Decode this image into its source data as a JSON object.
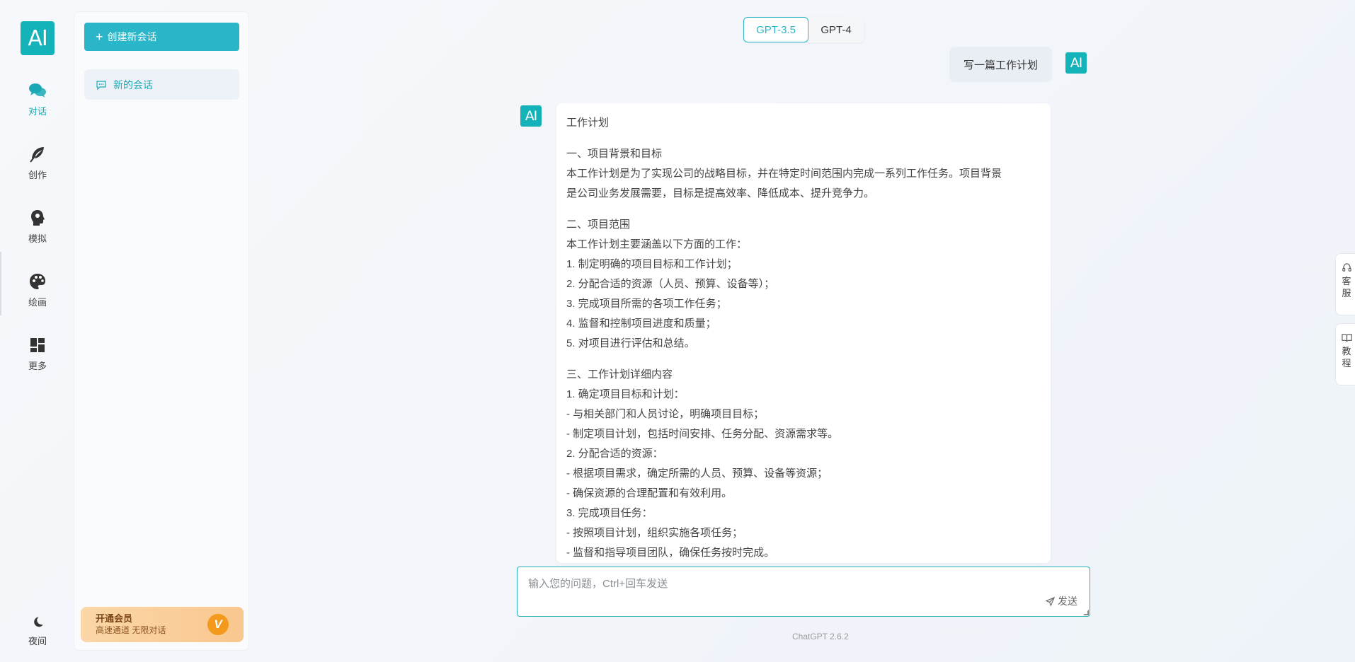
{
  "logo_text": "AI",
  "nav": {
    "items": [
      {
        "label": "对话",
        "icon": "chat-bubbles-icon"
      },
      {
        "label": "创作",
        "icon": "feather-icon"
      },
      {
        "label": "模拟",
        "icon": "head-profile-icon"
      },
      {
        "label": "绘画",
        "icon": "palette-icon"
      },
      {
        "label": "更多",
        "icon": "grid-icon"
      }
    ],
    "night_label": "夜间"
  },
  "sidebar": {
    "new_chat_label": "创建新会话",
    "sessions": [
      {
        "label": "新的会话"
      }
    ],
    "vip": {
      "title": "开通会员",
      "subtitle": "高速通道 无限对话",
      "badge": "V"
    }
  },
  "models": {
    "options": [
      "GPT-3.5",
      "GPT-4"
    ],
    "selected": "GPT-3.5"
  },
  "conversation": {
    "user_message": "写一篇工作计划",
    "user_avatar": "AI",
    "ai_avatar": "AI",
    "answer_paragraphs": [
      [
        "工作计划"
      ],
      [
        "一、项目背景和目标",
        "本工作计划是为了实现公司的战略目标，并在特定时间范围内完成一系列工作任务。项目背景",
        "是公司业务发展需要，目标是提高效率、降低成本、提升竞争力。"
      ],
      [
        "二、项目范围",
        "本工作计划主要涵盖以下方面的工作：",
        "1. 制定明确的项目目标和工作计划；",
        "2. 分配合适的资源（人员、预算、设备等）；",
        "3. 完成项目所需的各项工作任务；",
        "4. 监督和控制项目进度和质量；",
        "5. 对项目进行评估和总结。"
      ],
      [
        "三、工作计划详细内容",
        "1. 确定项目目标和计划：",
        "- 与相关部门和人员讨论，明确项目目标；",
        "- 制定项目计划，包括时间安排、任务分配、资源需求等。",
        "2. 分配合适的资源：",
        "- 根据项目需求，确定所需的人员、预算、设备等资源；",
        "- 确保资源的合理配置和有效利用。",
        "3. 完成项目任务：",
        "- 按照项目计划，组织实施各项任务；",
        "- 监督和指导项目团队，确保任务按时完成。"
      ]
    ]
  },
  "input": {
    "placeholder": "输入您的问题，Ctrl+回车发送",
    "value": "",
    "send_label": "发送"
  },
  "footer": {
    "version": "ChatGPT 2.6.2"
  },
  "float_tabs": [
    {
      "label": "客服",
      "icon": "headset-icon"
    },
    {
      "label": "教程",
      "icon": "book-icon"
    }
  ],
  "colors": {
    "accent": "#2ab6c8",
    "logo": "#14b2b9",
    "vip_badge": "#f39a1c"
  }
}
